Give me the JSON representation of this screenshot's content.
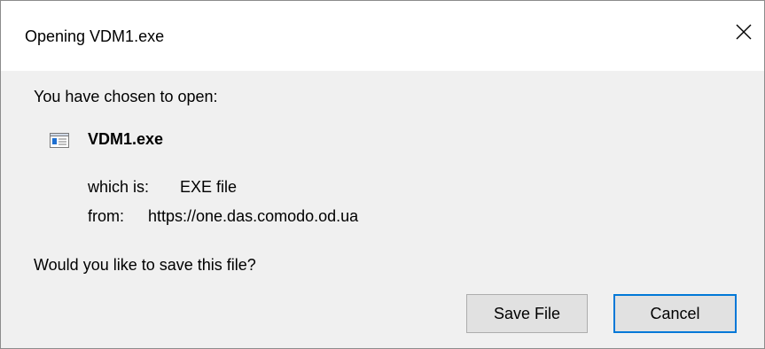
{
  "dialog": {
    "title": "Opening VDM1.exe",
    "close_icon": "close-icon"
  },
  "content": {
    "chosen_text": "You have chosen to open:",
    "file_name": "VDM1.exe",
    "file_icon": "executable-file-icon",
    "which_is_label": "which is:",
    "which_is_value": "EXE file",
    "from_label": "from:",
    "from_value": "https://one.das.comodo.od.ua",
    "question": "Would you like to save this file?"
  },
  "buttons": {
    "save_label": "Save File",
    "cancel_label": "Cancel"
  },
  "colors": {
    "content_background": "#f0f0f0",
    "button_background": "#e1e1e1",
    "focus_border": "#0078d7",
    "icon_blue": "#1e6fd0"
  }
}
